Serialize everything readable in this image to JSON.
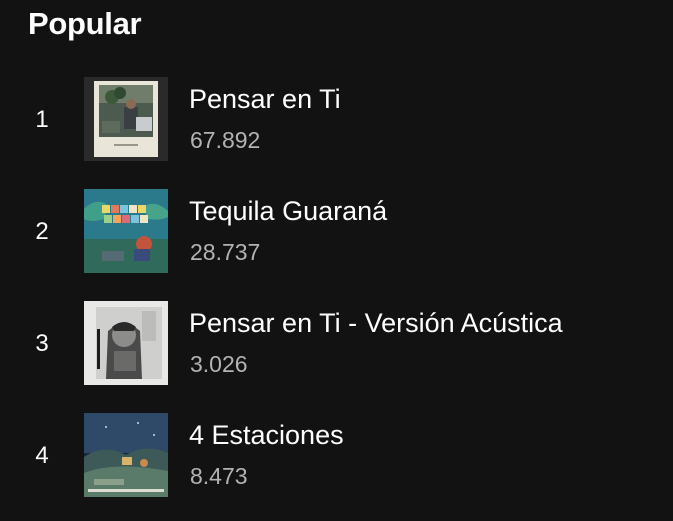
{
  "section": {
    "title": "Popular"
  },
  "tracks": [
    {
      "number": "1",
      "title": "Pensar en Ti",
      "plays": "67.892",
      "cover_icon": "album-cover-polaroid"
    },
    {
      "number": "2",
      "title": "Tequila Guaraná",
      "plays": "28.737",
      "cover_icon": "album-cover-illustrated"
    },
    {
      "number": "3",
      "title": "Pensar en Ti - Versión Acústica",
      "plays": "3.026",
      "cover_icon": "album-cover-bw-photo"
    },
    {
      "number": "4",
      "title": "4 Estaciones",
      "plays": "8.473",
      "cover_icon": "album-cover-night-landscape"
    }
  ],
  "colors": {
    "background": "#121212",
    "primary_text": "#ffffff",
    "secondary_text": "#b3b3b3"
  }
}
